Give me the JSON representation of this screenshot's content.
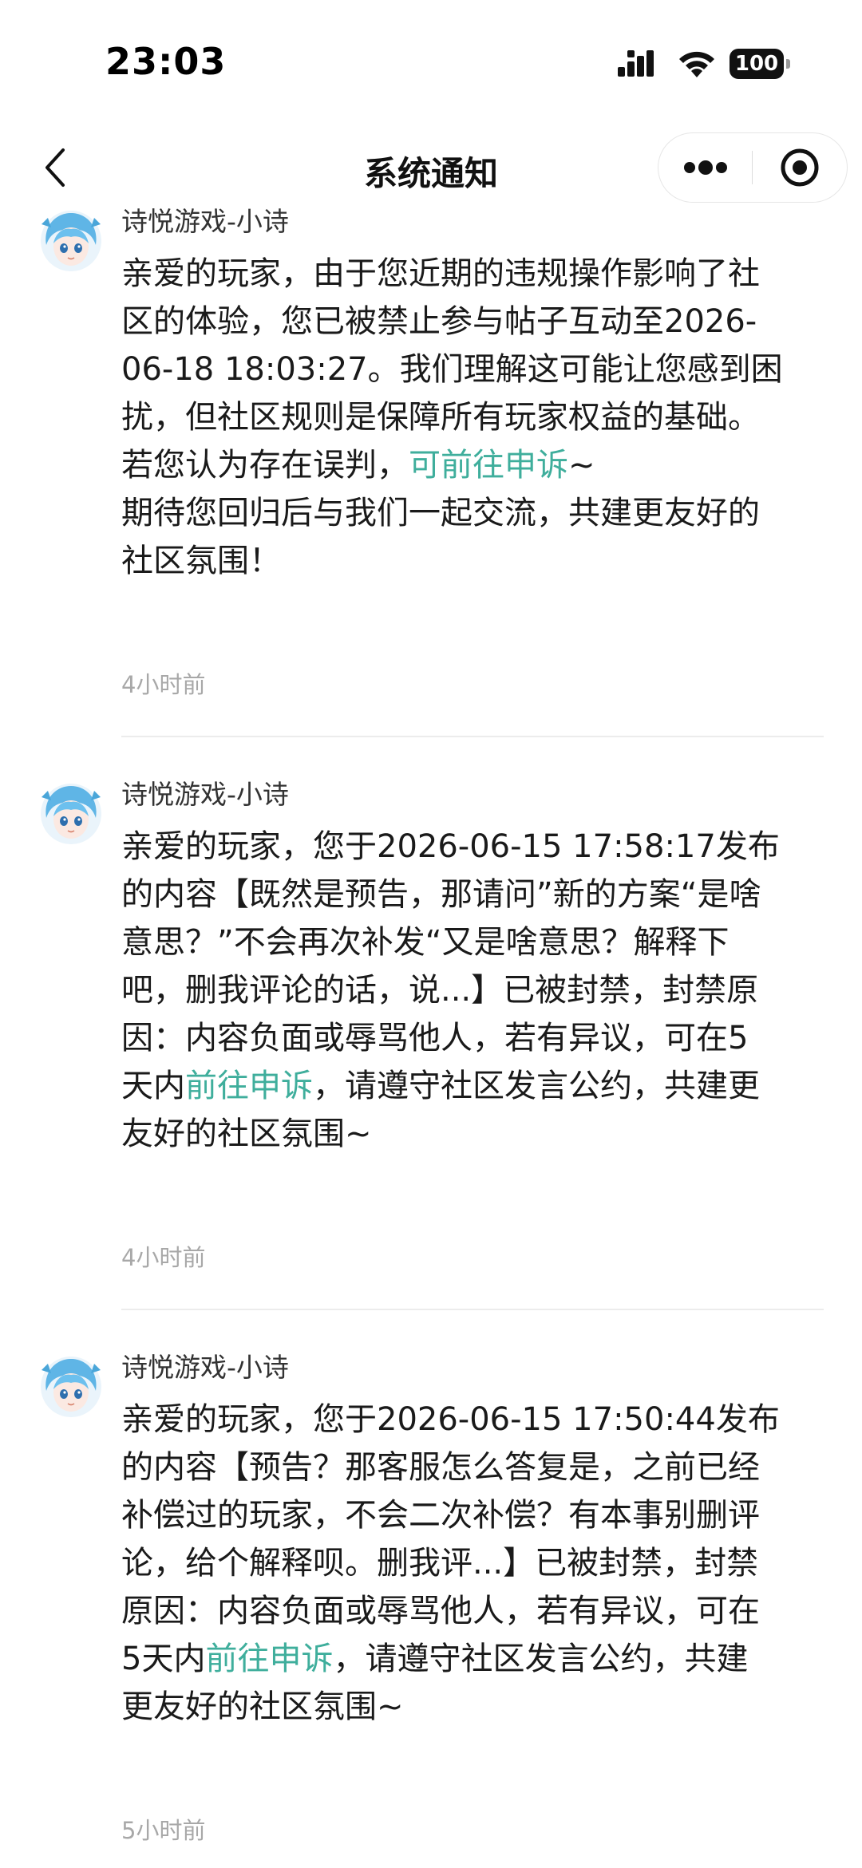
{
  "status_bar": {
    "time": "23:03",
    "battery": "100",
    "icons": [
      "signal-icon",
      "wifi-icon",
      "battery-icon"
    ]
  },
  "nav": {
    "title": "系统通知",
    "icons": [
      "back-icon",
      "more-icon",
      "close-mini-program-icon"
    ]
  },
  "colors": {
    "link": "#3fae9c",
    "time": "#a8a8a8",
    "divider": "#ececec"
  },
  "messages": [
    {
      "sender": "诗悦游戏-小诗",
      "lines": [
        "亲爱的玩家，由于您近期的违规操作影响了社",
        "区的体验，您已被禁止参与帖子互动至2026-",
        "06-18 18:03:27。我们理解这可能让您感到困",
        "扰，但社区规则是保障所有玩家权益的基础。"
      ],
      "appeal_prefix": "若您认为存在误判，",
      "appeal_link": "可前往申诉",
      "appeal_suffix": "~",
      "closing_lines": [
        "期待您回归后与我们一起交流，共建更友好的",
        "社区氛围！"
      ],
      "time": "4小时前"
    },
    {
      "sender": "诗悦游戏-小诗",
      "lines": [
        "亲爱的玩家，您于2026-06-15 17:58:17发布",
        "的内容【既然是预告，那请问”新的方案“是啥",
        "意思？”不会再次补发“又是啥意思？解释下",
        "吧，删我评论的话，说...】已被封禁，封禁原",
        "因：内容负面或辱骂他人，若有异议，可在5"
      ],
      "link_prefix": "天内",
      "link": "前往申诉",
      "link_suffix": "，请遵守社区发言公约，共建更",
      "closing_lines": [
        "友好的社区氛围~"
      ],
      "time": "4小时前"
    },
    {
      "sender": "诗悦游戏-小诗",
      "lines": [
        "亲爱的玩家，您于2026-06-15 17:50:44发布",
        "的内容【预告？那客服怎么答复是，之前已经",
        "补偿过的玩家，不会二次补偿？有本事别删评",
        "论，给个解释呗。删我评...】已被封禁，封禁",
        "原因：内容负面或辱骂他人，若有异议，可在"
      ],
      "link_prefix": "5天内",
      "link": "前往申诉",
      "link_suffix": "，请遵守社区发言公约，共建",
      "closing_lines": [
        "更友好的社区氛围~"
      ],
      "time": "5小时前"
    }
  ]
}
